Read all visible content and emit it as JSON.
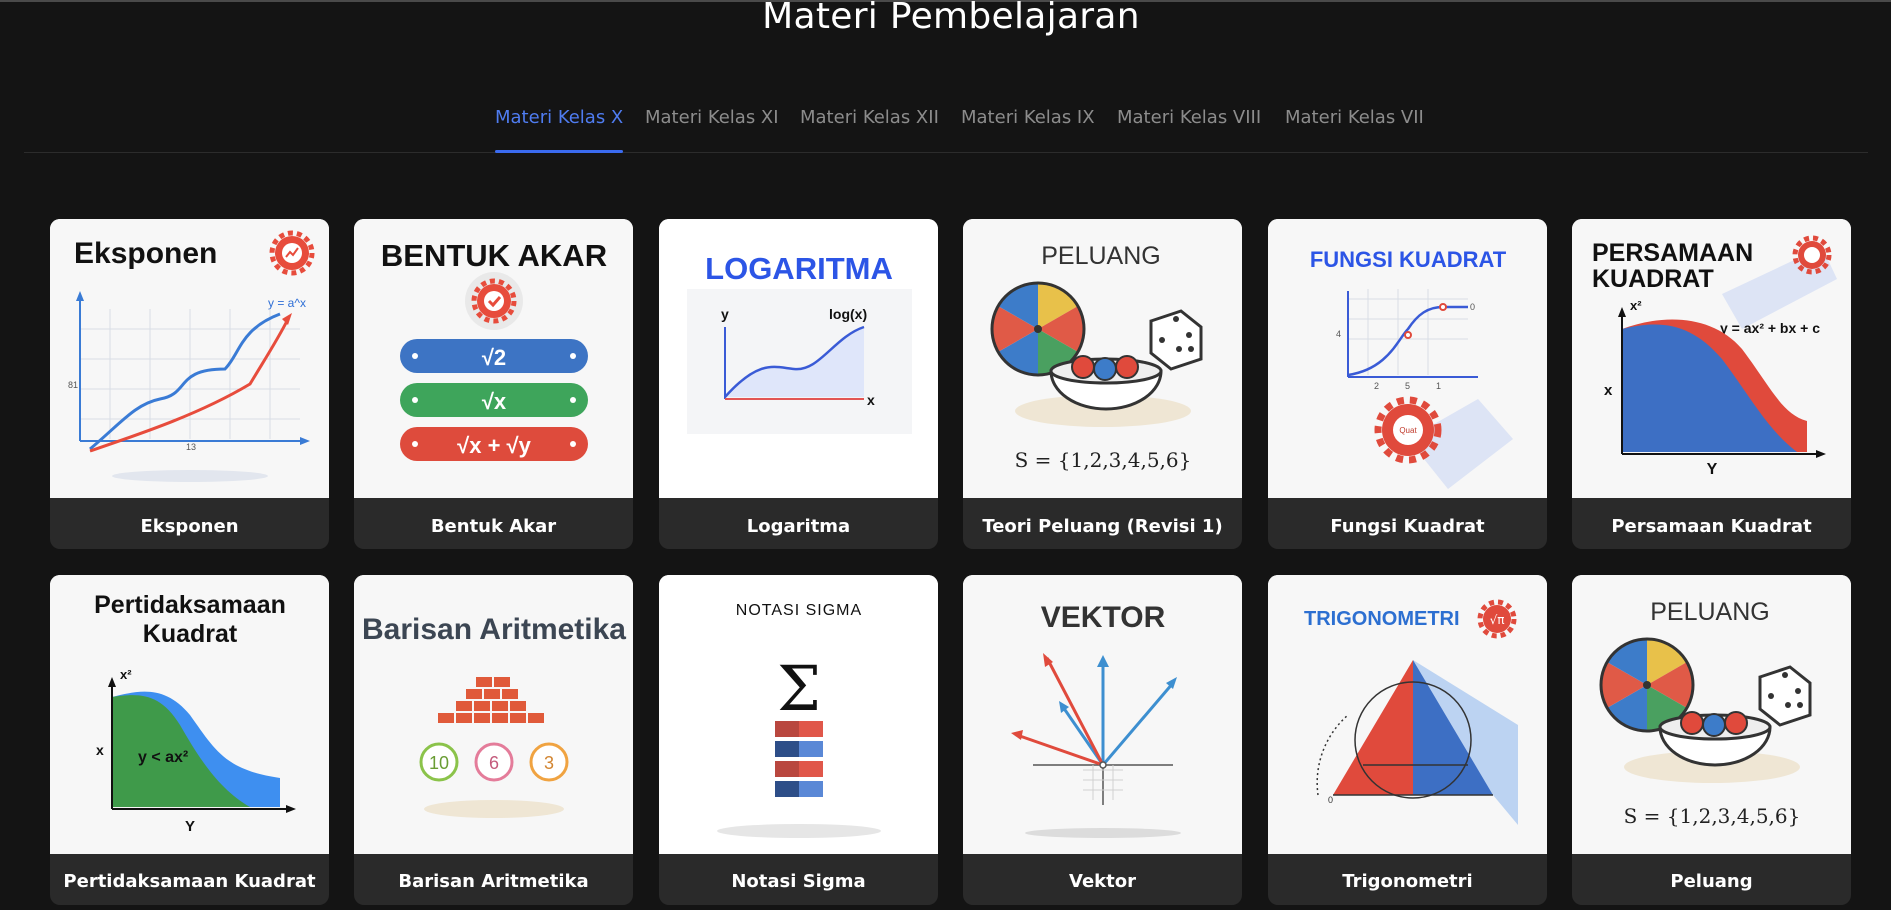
{
  "page": {
    "title": "Materi Pembelajaran"
  },
  "tabs": [
    {
      "label": "Materi Kelas X",
      "active": true
    },
    {
      "label": "Materi Kelas XI",
      "active": false
    },
    {
      "label": "Materi Kelas XII",
      "active": false
    },
    {
      "label": "Materi Kelas IX",
      "active": false
    },
    {
      "label": "Materi Kelas VIII",
      "active": false
    },
    {
      "label": "Materi Kelas VII",
      "active": false
    }
  ],
  "colors": {
    "accent": "#4f7cf0",
    "card_bg": "#2a2a2a",
    "page_bg": "#141414",
    "tab_inactive": "#8c8c8c"
  },
  "cards": [
    {
      "label": "Eksponen",
      "thumb": {
        "title": "Eksponen",
        "formula": "y = a^x",
        "ylabel": "81",
        "xlabel": "13",
        "icon": "gear-chart-icon"
      }
    },
    {
      "label": "Bentuk Akar",
      "thumb": {
        "title": "BENTUK AKAR",
        "pills": [
          "√2",
          "√x",
          "√x + √y"
        ],
        "icon": "gear-check-icon"
      }
    },
    {
      "label": "Logaritma",
      "thumb": {
        "title": "LOGARITMA",
        "ylabel": "y",
        "xlabel": "x",
        "formula": "log(x)"
      }
    },
    {
      "label": "Teori Peluang (Revisi 1)",
      "thumb": {
        "title": "PELUANG",
        "formula": "S = {1,2,3,4,5,6}",
        "icon": "dice-icon"
      }
    },
    {
      "label": "Fungsi Kuadrat",
      "thumb": {
        "title": "FUNGSI KUADRAT",
        "ticks": [
          "4",
          "2",
          "5",
          "1",
          "0"
        ],
        "badge": "Quat",
        "icon": "gear-icon"
      }
    },
    {
      "label": "Persamaan Kuadrat",
      "thumb": {
        "title_line1": "PERSAMAAN",
        "title_line2": "KUADRAT",
        "formula": "y = ax² + bx + c",
        "ylabel": "x²",
        "axis_x": "x",
        "axis_y": "Y",
        "icon": "gear-icon"
      }
    },
    {
      "label": "Pertidaksamaan Kuadrat",
      "thumb": {
        "title_line1": "Pertidaksamaan",
        "title_line2": "Kuadrat",
        "formula": "y < ax²",
        "ylabel": "x²",
        "axis_x": "x",
        "axis_y": "Y"
      }
    },
    {
      "label": "Barisan Aritmetika",
      "thumb": {
        "title": "Barisan Aritmetika",
        "circles": [
          "10",
          "6",
          "3"
        ]
      }
    },
    {
      "label": "Notasi Sigma",
      "thumb": {
        "title": "NOTASI SIGMA",
        "symbol": "Σ"
      }
    },
    {
      "label": "Vektor",
      "thumb": {
        "title": "VEKTOR"
      }
    },
    {
      "label": "Trigonometri",
      "thumb": {
        "title": "TRIGONOMETRI",
        "badge": "√π",
        "axis_zero": "0"
      }
    },
    {
      "label": "Peluang",
      "thumb": {
        "title": "PELUANG",
        "formula": "S = {1,2,3,4,5,6}",
        "icon": "dice-icon"
      }
    }
  ]
}
